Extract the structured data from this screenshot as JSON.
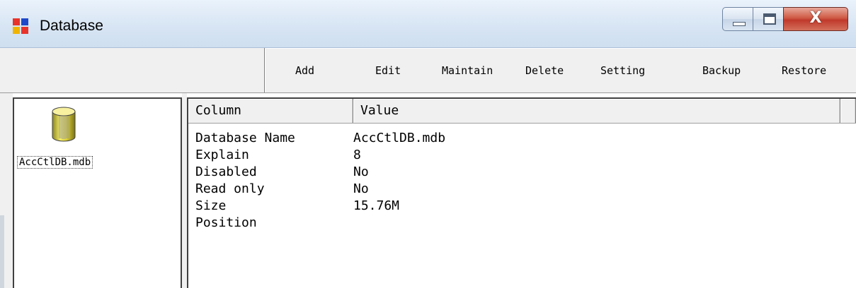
{
  "window": {
    "title": "Database",
    "app_icon": "app-blocks-icon"
  },
  "titlebar_buttons": {
    "minimize_icon": "minimize-icon",
    "maximize_icon": "maximize-icon",
    "close_glyph": "X"
  },
  "toolbar": {
    "buttons": [
      {
        "label": "Add"
      },
      {
        "label": "Edit"
      },
      {
        "label": "Maintain"
      },
      {
        "label": "Delete"
      },
      {
        "label": "Setting"
      },
      {
        "label": "Backup"
      },
      {
        "label": "Restore"
      }
    ]
  },
  "left_pane": {
    "item_label": "AccCtlDB.mdb",
    "item_icon": "database-cylinder-icon"
  },
  "table": {
    "headers": [
      "Column",
      "Value"
    ],
    "rows": [
      {
        "name": "Database Name",
        "value": "AccCtlDB.mdb"
      },
      {
        "name": "Explain",
        "value": "8"
      },
      {
        "name": "Disabled",
        "value": "No"
      },
      {
        "name": "Read only",
        "value": "No"
      },
      {
        "name": "Size",
        "value": "15.76M"
      },
      {
        "name": "Position",
        "value": ""
      }
    ]
  },
  "colors": {
    "titlebar": "#d6e4f3",
    "close_button": "#c0392b",
    "panel": "#f0f0f0",
    "db_icon": "#e6dc3a"
  }
}
